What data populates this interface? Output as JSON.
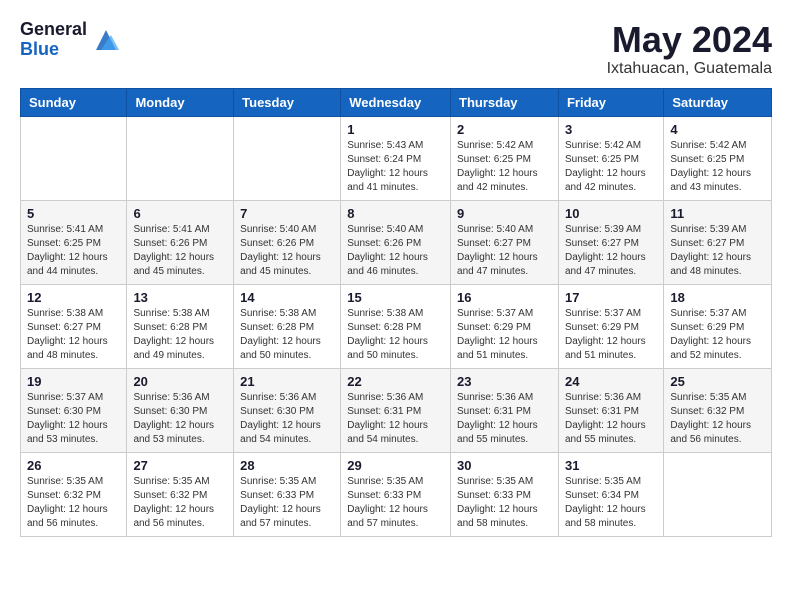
{
  "header": {
    "logo_general": "General",
    "logo_blue": "Blue",
    "month_year": "May 2024",
    "location": "Ixtahuacan, Guatemala"
  },
  "days_of_week": [
    "Sunday",
    "Monday",
    "Tuesday",
    "Wednesday",
    "Thursday",
    "Friday",
    "Saturday"
  ],
  "weeks": [
    [
      {
        "day": "",
        "info": ""
      },
      {
        "day": "",
        "info": ""
      },
      {
        "day": "",
        "info": ""
      },
      {
        "day": "1",
        "info": "Sunrise: 5:43 AM\nSunset: 6:24 PM\nDaylight: 12 hours\nand 41 minutes."
      },
      {
        "day": "2",
        "info": "Sunrise: 5:42 AM\nSunset: 6:25 PM\nDaylight: 12 hours\nand 42 minutes."
      },
      {
        "day": "3",
        "info": "Sunrise: 5:42 AM\nSunset: 6:25 PM\nDaylight: 12 hours\nand 42 minutes."
      },
      {
        "day": "4",
        "info": "Sunrise: 5:42 AM\nSunset: 6:25 PM\nDaylight: 12 hours\nand 43 minutes."
      }
    ],
    [
      {
        "day": "5",
        "info": "Sunrise: 5:41 AM\nSunset: 6:25 PM\nDaylight: 12 hours\nand 44 minutes."
      },
      {
        "day": "6",
        "info": "Sunrise: 5:41 AM\nSunset: 6:26 PM\nDaylight: 12 hours\nand 45 minutes."
      },
      {
        "day": "7",
        "info": "Sunrise: 5:40 AM\nSunset: 6:26 PM\nDaylight: 12 hours\nand 45 minutes."
      },
      {
        "day": "8",
        "info": "Sunrise: 5:40 AM\nSunset: 6:26 PM\nDaylight: 12 hours\nand 46 minutes."
      },
      {
        "day": "9",
        "info": "Sunrise: 5:40 AM\nSunset: 6:27 PM\nDaylight: 12 hours\nand 47 minutes."
      },
      {
        "day": "10",
        "info": "Sunrise: 5:39 AM\nSunset: 6:27 PM\nDaylight: 12 hours\nand 47 minutes."
      },
      {
        "day": "11",
        "info": "Sunrise: 5:39 AM\nSunset: 6:27 PM\nDaylight: 12 hours\nand 48 minutes."
      }
    ],
    [
      {
        "day": "12",
        "info": "Sunrise: 5:38 AM\nSunset: 6:27 PM\nDaylight: 12 hours\nand 48 minutes."
      },
      {
        "day": "13",
        "info": "Sunrise: 5:38 AM\nSunset: 6:28 PM\nDaylight: 12 hours\nand 49 minutes."
      },
      {
        "day": "14",
        "info": "Sunrise: 5:38 AM\nSunset: 6:28 PM\nDaylight: 12 hours\nand 50 minutes."
      },
      {
        "day": "15",
        "info": "Sunrise: 5:38 AM\nSunset: 6:28 PM\nDaylight: 12 hours\nand 50 minutes."
      },
      {
        "day": "16",
        "info": "Sunrise: 5:37 AM\nSunset: 6:29 PM\nDaylight: 12 hours\nand 51 minutes."
      },
      {
        "day": "17",
        "info": "Sunrise: 5:37 AM\nSunset: 6:29 PM\nDaylight: 12 hours\nand 51 minutes."
      },
      {
        "day": "18",
        "info": "Sunrise: 5:37 AM\nSunset: 6:29 PM\nDaylight: 12 hours\nand 52 minutes."
      }
    ],
    [
      {
        "day": "19",
        "info": "Sunrise: 5:37 AM\nSunset: 6:30 PM\nDaylight: 12 hours\nand 53 minutes."
      },
      {
        "day": "20",
        "info": "Sunrise: 5:36 AM\nSunset: 6:30 PM\nDaylight: 12 hours\nand 53 minutes."
      },
      {
        "day": "21",
        "info": "Sunrise: 5:36 AM\nSunset: 6:30 PM\nDaylight: 12 hours\nand 54 minutes."
      },
      {
        "day": "22",
        "info": "Sunrise: 5:36 AM\nSunset: 6:31 PM\nDaylight: 12 hours\nand 54 minutes."
      },
      {
        "day": "23",
        "info": "Sunrise: 5:36 AM\nSunset: 6:31 PM\nDaylight: 12 hours\nand 55 minutes."
      },
      {
        "day": "24",
        "info": "Sunrise: 5:36 AM\nSunset: 6:31 PM\nDaylight: 12 hours\nand 55 minutes."
      },
      {
        "day": "25",
        "info": "Sunrise: 5:35 AM\nSunset: 6:32 PM\nDaylight: 12 hours\nand 56 minutes."
      }
    ],
    [
      {
        "day": "26",
        "info": "Sunrise: 5:35 AM\nSunset: 6:32 PM\nDaylight: 12 hours\nand 56 minutes."
      },
      {
        "day": "27",
        "info": "Sunrise: 5:35 AM\nSunset: 6:32 PM\nDaylight: 12 hours\nand 56 minutes."
      },
      {
        "day": "28",
        "info": "Sunrise: 5:35 AM\nSunset: 6:33 PM\nDaylight: 12 hours\nand 57 minutes."
      },
      {
        "day": "29",
        "info": "Sunrise: 5:35 AM\nSunset: 6:33 PM\nDaylight: 12 hours\nand 57 minutes."
      },
      {
        "day": "30",
        "info": "Sunrise: 5:35 AM\nSunset: 6:33 PM\nDaylight: 12 hours\nand 58 minutes."
      },
      {
        "day": "31",
        "info": "Sunrise: 5:35 AM\nSunset: 6:34 PM\nDaylight: 12 hours\nand 58 minutes."
      },
      {
        "day": "",
        "info": ""
      }
    ]
  ]
}
